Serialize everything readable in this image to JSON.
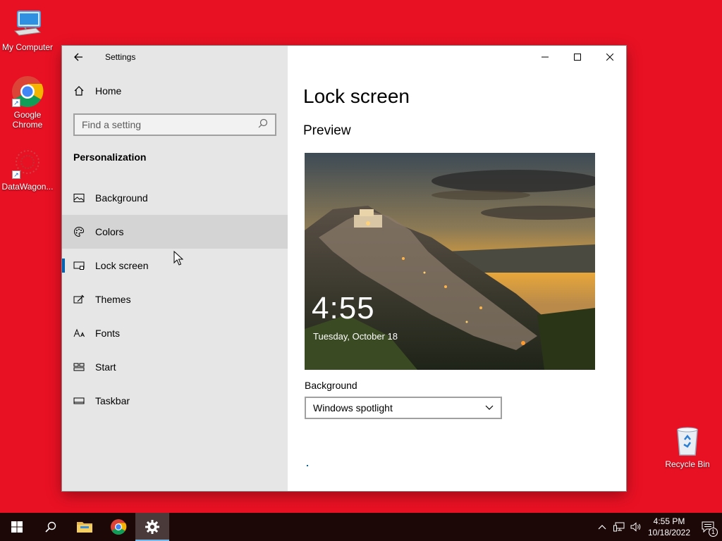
{
  "desktop": {
    "icons": [
      {
        "label": "My Computer"
      },
      {
        "label": "Google Chrome"
      },
      {
        "label": "DataWagon..."
      },
      {
        "label": "Recycle Bin"
      }
    ]
  },
  "window": {
    "app_title": "Settings",
    "controls": {
      "minimize": "minimize-icon",
      "maximize": "maximize-icon",
      "close": "close-icon"
    }
  },
  "nav": {
    "home_label": "Home",
    "search_placeholder": "Find a setting",
    "section_title": "Personalization",
    "items": [
      {
        "label": "Background",
        "icon": "picture-icon"
      },
      {
        "label": "Colors",
        "icon": "palette-icon"
      },
      {
        "label": "Lock screen",
        "icon": "lock-screen-icon"
      },
      {
        "label": "Themes",
        "icon": "themes-icon"
      },
      {
        "label": "Fonts",
        "icon": "fonts-icon"
      },
      {
        "label": "Start",
        "icon": "start-icon"
      },
      {
        "label": "Taskbar",
        "icon": "taskbar-icon"
      }
    ],
    "selected": "Lock screen",
    "hovered": "Colors"
  },
  "content": {
    "page_title": "Lock screen",
    "preview_heading": "Preview",
    "preview_time": "4:55",
    "preview_date": "Tuesday, October 18",
    "background_label": "Background",
    "background_value": "Windows spotlight"
  },
  "taskbar": {
    "clock_time": "4:55 PM",
    "clock_date": "10/18/2022",
    "notification_count": "1"
  },
  "colors": {
    "desktop_bg": "#e81123",
    "accent": "#0063b1",
    "taskbar_bg": "#1d0808"
  }
}
